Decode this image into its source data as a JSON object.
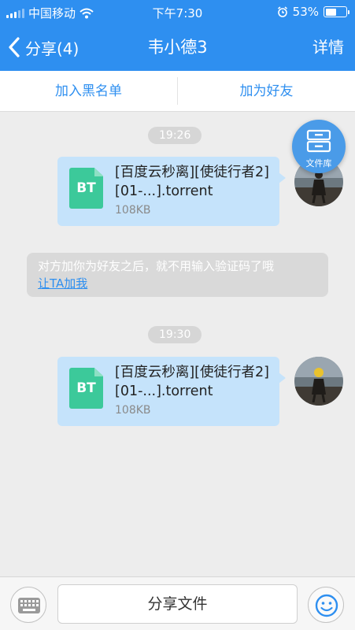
{
  "status_bar": {
    "carrier": "中国移动",
    "time": "下午7:30",
    "battery_percent": "53%",
    "battery_level": 0.53
  },
  "nav": {
    "back_label": "分享(4)",
    "title": "韦小德3",
    "detail_label": "详情"
  },
  "actions": {
    "block_label": "加入黑名单",
    "add_friend_label": "加为好友"
  },
  "messages": [
    {
      "time": "19:26",
      "file_type": "BT",
      "file_name": "[百度云秒离][使徒行者2][01-...].torrent",
      "file_size": "108KB"
    },
    {
      "time": "19:30",
      "file_type": "BT",
      "file_name": "[百度云秒离][使徒行者2][01-...].torrent",
      "file_size": "108KB"
    }
  ],
  "notice": {
    "text": "对方加你为好友之后，就不用输入验证码了哦",
    "link": "让TA加我"
  },
  "file_library": {
    "label": "文件库"
  },
  "bottom": {
    "share_label": "分享文件"
  },
  "colors": {
    "accent": "#2e8ff0",
    "bubble": "#c5e3fb",
    "file_icon": "#3cc99a"
  },
  "icons": [
    "signal-icon",
    "wifi-icon",
    "alarm-icon",
    "battery-icon",
    "back-chevron-icon",
    "drawer-icon",
    "keyboard-icon",
    "smiley-icon"
  ]
}
